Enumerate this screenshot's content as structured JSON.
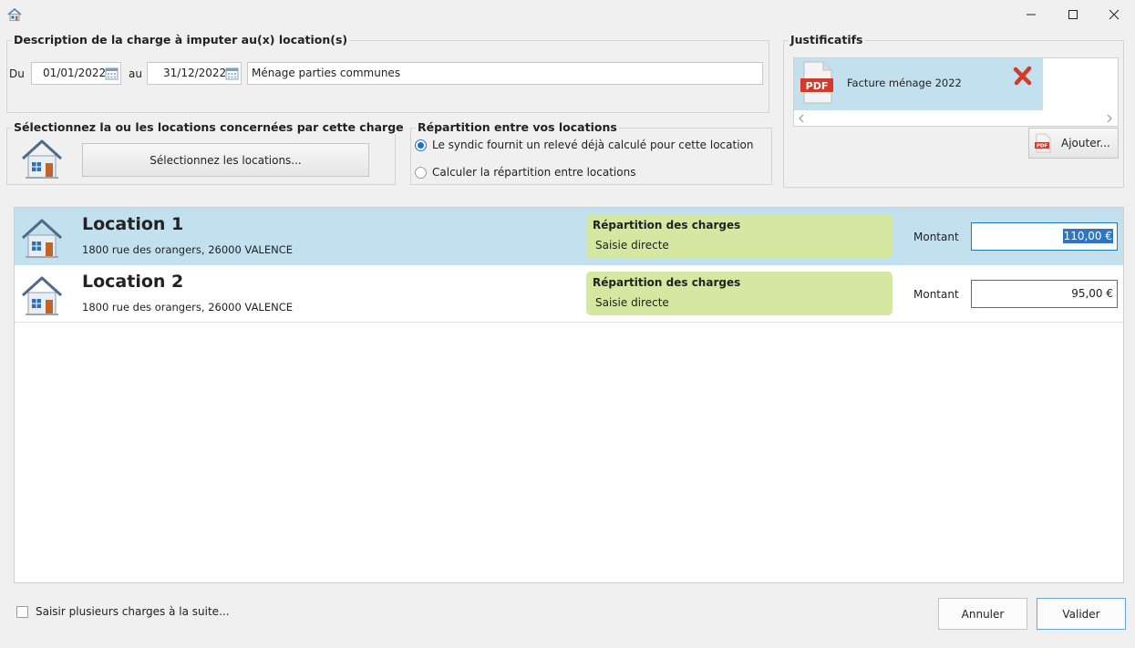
{
  "colors": {
    "accent": "#1e7bc2",
    "row_selected": "#c3e0ee",
    "repartition_bg": "#d4e8a2",
    "pdf_red": "#d23a2c"
  },
  "window": {
    "minimize_icon": "minimize-icon",
    "maximize_icon": "maximize-icon",
    "close_icon": "close-icon"
  },
  "description": {
    "title": "Description de la charge à imputer au(x) location(s)",
    "from_label": "Du",
    "from_date": "01/01/2022",
    "to_label": "au",
    "to_date": "31/12/2022",
    "label_value": "Ménage parties communes"
  },
  "justificatifs": {
    "title": "Justificatifs",
    "files": [
      {
        "name": "Facture ménage 2022",
        "type": "PDF"
      }
    ],
    "add_label": "Ajouter..."
  },
  "selection": {
    "title": "Sélectionnez la ou les locations concernées par cette charge",
    "button_label": "Sélectionnez les locations..."
  },
  "repartition": {
    "title": "Répartition entre vos locations",
    "options": [
      {
        "label": "Le syndic fournit un relevé déjà calculé pour cette location",
        "selected": true
      },
      {
        "label": "Calculer la répartition entre locations",
        "selected": false
      }
    ]
  },
  "locations": [
    {
      "name": "Location 1",
      "address": "1800 rue des orangers, 26000 VALENCE",
      "rep_title": "Répartition des charges",
      "rep_value": "Saisie directe",
      "montant_label": "Montant",
      "amount": "110,00 €",
      "selected": true
    },
    {
      "name": "Location 2",
      "address": "1800 rue des orangers, 26000 VALENCE",
      "rep_title": "Répartition des charges",
      "rep_value": "Saisie directe",
      "montant_label": "Montant",
      "amount": "95,00 €",
      "selected": false
    }
  ],
  "footer": {
    "multi_label": "Saisir plusieurs charges à la suite...",
    "cancel_label": "Annuler",
    "validate_label": "Valider"
  }
}
